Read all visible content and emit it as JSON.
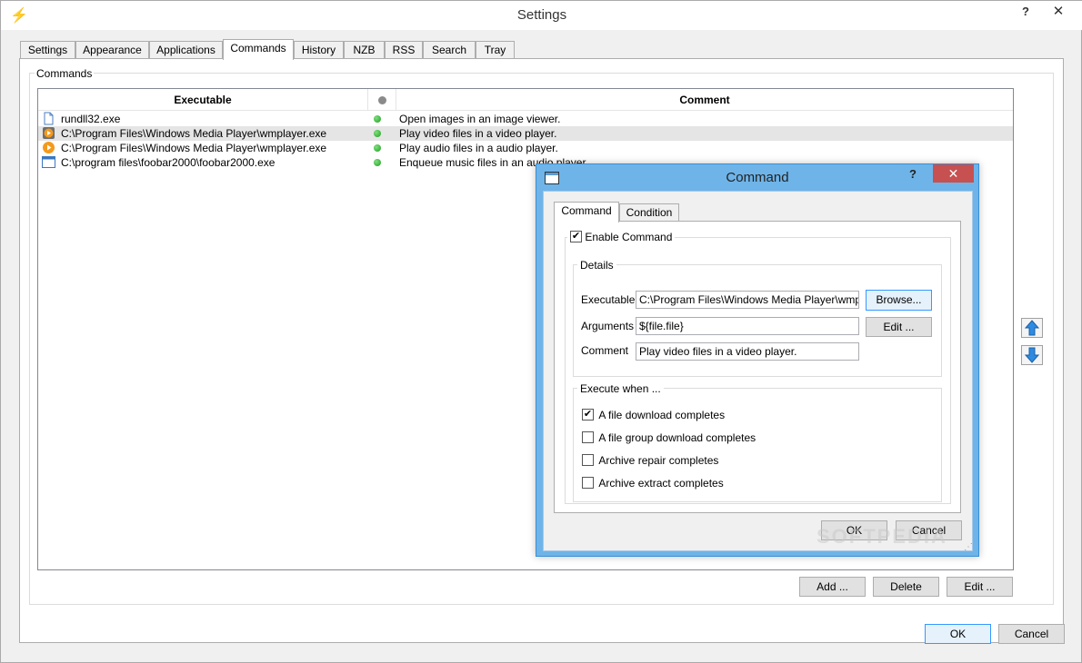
{
  "window": {
    "title": "Settings",
    "help_label": "?",
    "close_label": "✕"
  },
  "tabs": [
    {
      "label": "Settings"
    },
    {
      "label": "Appearance"
    },
    {
      "label": "Applications"
    },
    {
      "label": "Commands",
      "active": true
    },
    {
      "label": "History"
    },
    {
      "label": "NZB"
    },
    {
      "label": "RSS"
    },
    {
      "label": "Search"
    },
    {
      "label": "Tray"
    }
  ],
  "commands": {
    "group_label": "Commands",
    "columns": {
      "executable": "Executable",
      "comment": "Comment"
    },
    "rows": [
      {
        "icon": "generic-file-icon",
        "executable": "rundll32.exe",
        "enabled": true,
        "comment": "Open images in an image viewer.",
        "selected": false
      },
      {
        "icon": "media-player-icon",
        "executable": "C:\\Program Files\\Windows Media Player\\wmplayer.exe",
        "enabled": true,
        "comment": "Play video files in a video player.",
        "selected": true
      },
      {
        "icon": "media-player-icon",
        "executable": "C:\\Program Files\\Windows Media Player\\wmplayer.exe",
        "enabled": true,
        "comment": "Play audio files in a audio player.",
        "selected": false
      },
      {
        "icon": "window-app-icon",
        "executable": "C:\\program files\\foobar2000\\foobar2000.exe",
        "enabled": true,
        "comment": "Enqueue music files in an audio player.",
        "selected": false
      }
    ],
    "buttons": {
      "add": "Add ...",
      "delete": "Delete",
      "edit": "Edit ..."
    }
  },
  "footer": {
    "ok": "OK",
    "cancel": "Cancel"
  },
  "dialog": {
    "title": "Command",
    "help_label": "?",
    "close_label": "✕",
    "tabs": [
      {
        "label": "Command",
        "active": true
      },
      {
        "label": "Condition"
      }
    ],
    "enable_command": {
      "label": "Enable Command",
      "checked": true
    },
    "details": {
      "label": "Details",
      "executable_label": "Executable",
      "executable_value": "C:\\Program Files\\Windows Media Player\\wmplayer.",
      "browse_label": "Browse...",
      "arguments_label": "Arguments",
      "arguments_value": "${file.file}",
      "edit_label": "Edit ...",
      "comment_label": "Comment",
      "comment_value": "Play video files in a video player."
    },
    "execute_when": {
      "label": "Execute when ...",
      "options": [
        {
          "label": "A file download completes",
          "checked": true
        },
        {
          "label": "A file group download completes",
          "checked": false
        },
        {
          "label": "Archive repair completes",
          "checked": false
        },
        {
          "label": "Archive extract completes",
          "checked": false
        }
      ]
    },
    "ok": "OK",
    "cancel": "Cancel"
  },
  "watermark": "SOFTPEDIA",
  "colors": {
    "status_enabled": "#2db52d",
    "dialog_frame": "#6eb4e8",
    "dialog_close": "#c75050",
    "selected_row": "#e5e5e5"
  }
}
